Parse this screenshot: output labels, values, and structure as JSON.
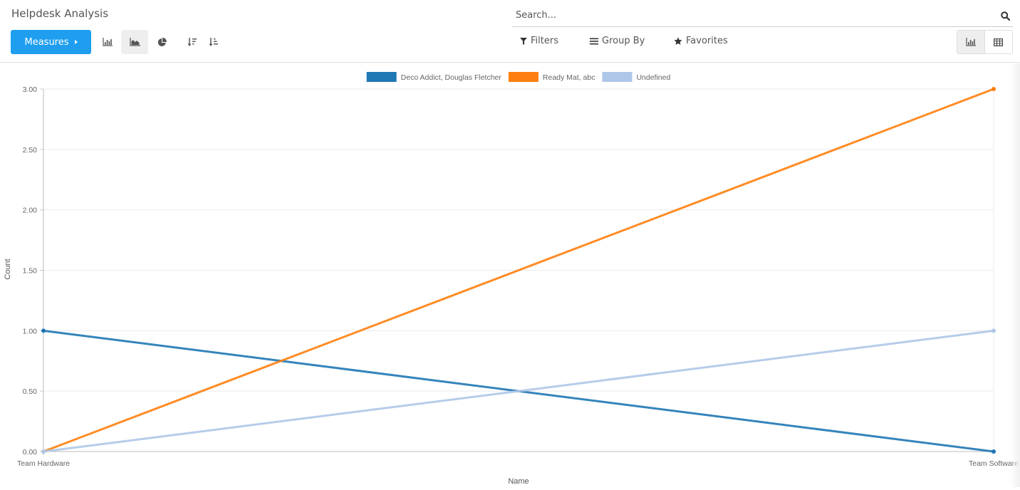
{
  "header": {
    "title": "Helpdesk Analysis",
    "measures_label": "Measures",
    "search_placeholder": "Search...",
    "filters_label": "Filters",
    "groupby_label": "Group By",
    "favorites_label": "Favorites"
  },
  "toolbar": {
    "chart_types": [
      {
        "name": "bar",
        "icon": "bar-chart-icon",
        "active": false
      },
      {
        "name": "line",
        "icon": "area-chart-icon",
        "active": true
      },
      {
        "name": "pie",
        "icon": "pie-chart-icon",
        "active": false
      }
    ],
    "sort": [
      {
        "name": "descending",
        "icon": "sort-amount-desc-icon"
      },
      {
        "name": "ascending",
        "icon": "sort-amount-asc-icon"
      }
    ],
    "views": [
      {
        "name": "graph",
        "icon": "bar-chart-icon",
        "active": true
      },
      {
        "name": "pivot",
        "icon": "table-icon",
        "active": false
      }
    ]
  },
  "chart_data": {
    "type": "line",
    "title": "",
    "xlabel": "Name",
    "ylabel": "Count",
    "categories": [
      "Team Hardware",
      "Team Software"
    ],
    "ylim": [
      0,
      3
    ],
    "yticks": [
      "0.00",
      "0.50",
      "1.00",
      "1.50",
      "2.00",
      "2.50",
      "3.00"
    ],
    "grid": true,
    "legend_position": "top-center",
    "series": [
      {
        "name": "Deco Addict, Douglas Fletcher",
        "values": [
          1,
          0
        ],
        "color": "#1f77b4"
      },
      {
        "name": "Ready Mat, abc",
        "values": [
          0,
          3
        ],
        "color": "#ff7f0e"
      },
      {
        "name": "Undefined",
        "values": [
          0,
          1
        ],
        "color": "#aec7e8"
      }
    ]
  }
}
